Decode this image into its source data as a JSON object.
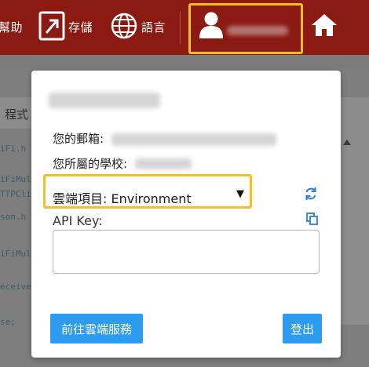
{
  "topbar": {
    "help_label": "幫助",
    "storage_label": "存儲",
    "language_label": "語言",
    "user_name": ""
  },
  "background": {
    "panel_title": "程式",
    "code_lines": [
      "iFi.h",
      "iFiMul",
      "TTPCli",
      "son.h",
      "iFiMul",
      "eceive",
      "se;"
    ]
  },
  "modal": {
    "blurred_header": "",
    "email_label": "您的郵箱:",
    "school_label": "您所屬的學校:",
    "project_select": {
      "selected": "雲端項目: Environment"
    },
    "api_key_label": "API Key:",
    "api_key_value": "",
    "go_cloud_button": "前往雲端服務",
    "logout_button": "登出"
  },
  "colors": {
    "topbar": "#8a1a12",
    "highlight": "#f6be21",
    "button": "#2d9bee",
    "accent": "#2c7fd6"
  }
}
